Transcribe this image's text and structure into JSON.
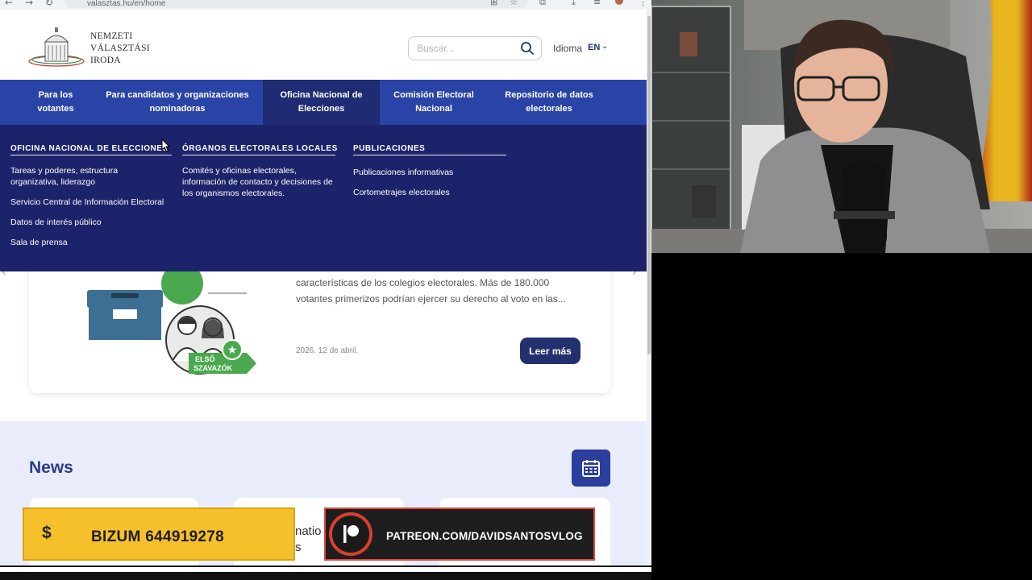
{
  "browser": {
    "url": "valasztas.hu/en/home",
    "back_glyph": "←",
    "forward_glyph": "→",
    "reload_glyph": "↻"
  },
  "site": {
    "logo_lines": [
      "NEMZETI",
      "VÁLASZTÁSI",
      "IRODA"
    ],
    "search_placeholder": "Buscar...",
    "language_label": "Idioma",
    "language_value": "EN"
  },
  "main_nav": [
    {
      "label": "Para los votantes",
      "active": false
    },
    {
      "label": "Para candidatos y organizaciones nominadoras",
      "active": false
    },
    {
      "label": "Oficina Nacional de Elecciones",
      "active": true
    },
    {
      "label": "Comisión Electoral Nacional",
      "active": false
    },
    {
      "label": "Repositorio de datos electorales",
      "active": false
    }
  ],
  "mega_menu": {
    "columns": [
      {
        "heading": "OFICINA NACIONAL DE ELECCIONES",
        "links": [
          "Tareas y poderes, estructura organizativa, liderazgo",
          "Servicio Central de Información Electoral",
          "Datos de interés público",
          "Sala de prensa"
        ]
      },
      {
        "heading": "ÓRGANOS ELECTORALES LOCALES",
        "links": [
          "Comités y oficinas electorales, información de contacto y decisiones de los organismos electorales."
        ]
      },
      {
        "heading": "PUBLICACIONES",
        "links": [
          "Publicaciones informativas",
          "Cortometrajes electorales"
        ]
      }
    ]
  },
  "featured": {
    "excerpt": "características de los colegios electorales. Más de 180.000 votantes primerizos podrían ejercer su derecho al voto en las...",
    "date": "2026. 12 de abril.",
    "read_more": "Leer más",
    "badge_text_1": "ELSŐ",
    "badge_text_2": "SZAVAZÓK"
  },
  "news": {
    "title": "News",
    "snippet_1": "natio",
    "snippet_2": "s"
  },
  "overlays": {
    "bizum_symbol": "$",
    "bizum_text": "BIZUM 644919278",
    "patreon_text": "PATREON.COM/DAVIDSANTOSVLOG"
  },
  "colors": {
    "nav_blue": "#2a43a6",
    "nav_active": "#1f2c74",
    "mega_menu_bg": "#1d236a",
    "button_navy": "#23306f",
    "news_bg": "#e9ecfb",
    "bizum_yellow": "#f5c02a",
    "patreon_red": "#e0473a"
  }
}
